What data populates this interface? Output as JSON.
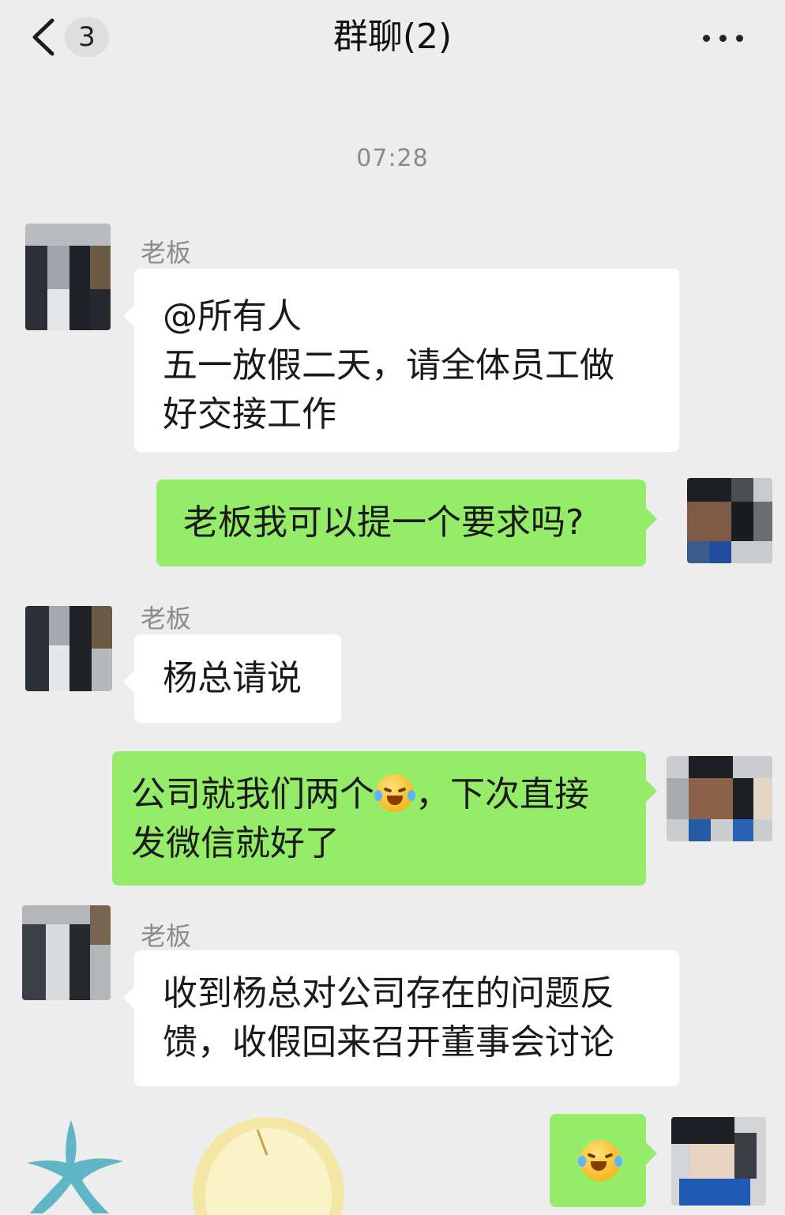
{
  "header": {
    "back_icon": "chevron-left-icon",
    "unread_count": "3",
    "title": "群聊(2)",
    "more_icon": "more-dots-icon"
  },
  "timestamp": "07:28",
  "messages": [
    {
      "side": "left",
      "sender": "老板",
      "lines": [
        "@所有人",
        "五一放假二天，请全体员工做",
        "好交接工作"
      ]
    },
    {
      "side": "right",
      "lines": [
        "老板我可以提一个要求吗?"
      ]
    },
    {
      "side": "left",
      "sender": "老板",
      "lines": [
        "杨总请说"
      ]
    },
    {
      "side": "right",
      "lines": [
        "公司就我们两个",
        "，下次直接",
        "发微信就好了"
      ],
      "emoji": "laughing-crying-emoji"
    },
    {
      "side": "left",
      "sender": "老板",
      "lines": [
        "收到杨总对公司存在的问题反",
        "馈，收假回来召开董事会讨论"
      ]
    },
    {
      "side": "right",
      "emoji": "laughing-crying-emoji"
    }
  ],
  "colors": {
    "background": "#ededed",
    "bubble_self": "#95ec69",
    "bubble_other": "#ffffff",
    "timestamp": "#8a8a8a",
    "sender_name": "#8b8b8b"
  }
}
